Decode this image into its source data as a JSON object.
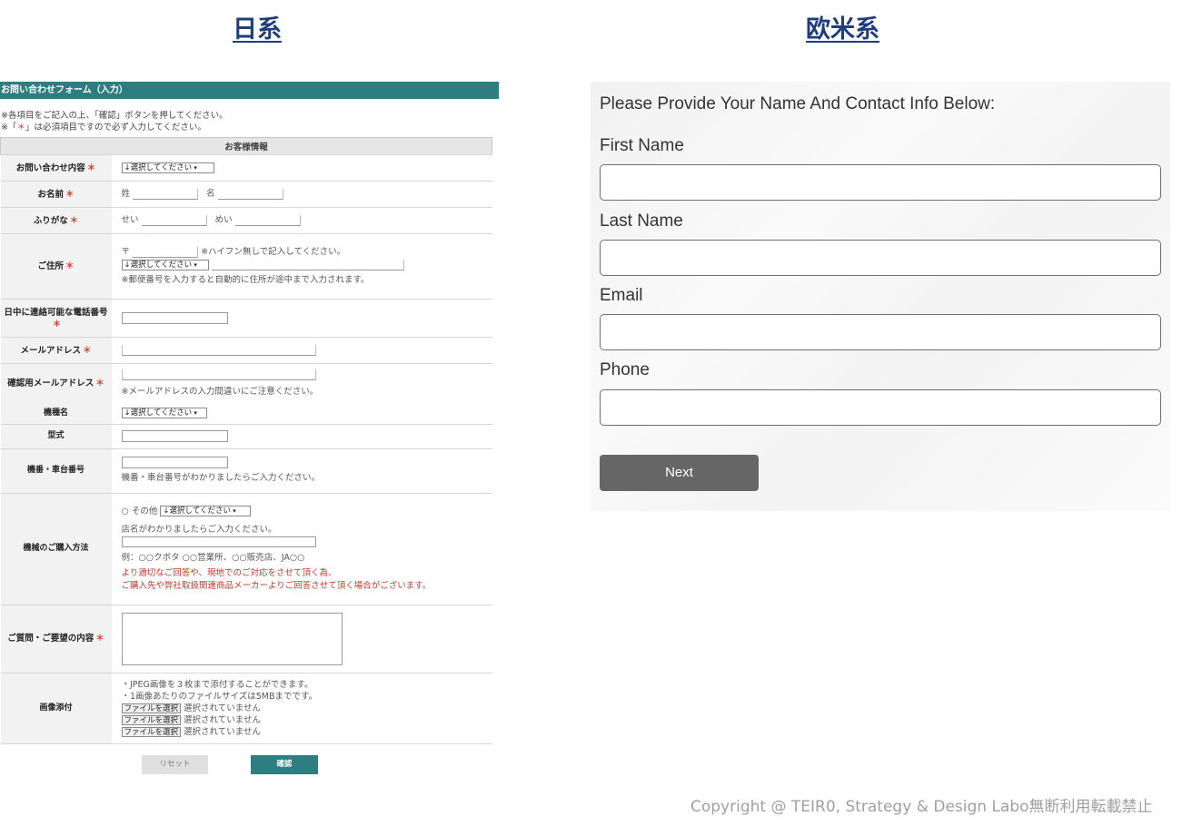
{
  "headings": {
    "jp": "日系",
    "west": "欧米系"
  },
  "jp_form": {
    "title": "お問い合わせフォーム（入力）",
    "note1": "※各項目をご記入の上、「確認」ボタンを押してください。",
    "note2_pre": "※「",
    "note2_mark": "＊",
    "note2_post": "」は必須項目ですので必ず入力してください。",
    "section": "お客様情報",
    "req_mark": "＊",
    "select_placeholder": "↓選択してください",
    "labels": {
      "inquiry": "お問い合わせ内容",
      "name": "お名前",
      "furigana": "ふりがな",
      "address": "ご住所",
      "phone": "日中に連絡可能な電話番号",
      "email": "メールアドレス",
      "email_confirm": "確認用メールアドレス",
      "model_name": "機種名",
      "model_type": "型式",
      "serial": "機番・車台番号",
      "purchase": "機械のご購入方法",
      "question": "ご質問・ご要望の内容",
      "image": "画像添付"
    },
    "name_sei": "姓",
    "name_mei": "名",
    "kana_sei": "せい",
    "kana_mei": "めい",
    "postal_mark": "〒",
    "postal_hint": "※ハイフン無しで記入してください。",
    "address_hint": "※郵便番号を入力すると自動的に住所が途中まで入力されます。",
    "email_hint": "※メールアドレスの入力間違いにご注意ください。",
    "serial_hint": "機番・車台番号がわかりましたらご入力ください。",
    "purchase_other": "その他",
    "purchase_store_hint": "店名がわかりましたらご入力ください。",
    "purchase_example": "例：○○クボタ ○○営業所、○○販売店、JA○○",
    "purchase_red1": "より適切なご回答や、現地でのご対応をさせて頂く為、",
    "purchase_red2": "ご購入先や弊社取扱関連商品メーカーよりご回答させて頂く場合がございます。",
    "image_note1": "・JPEG画像を３枚まで添付することができます。",
    "image_note2": "・1画像あたりのファイルサイズは5MBまでです。",
    "file_button": "ファイルを選択",
    "file_status": "選択されていません",
    "reset": "リセット",
    "confirm": "確認"
  },
  "west_form": {
    "intro": "Please Provide Your Name And Contact Info Below:",
    "first_name": "First Name",
    "last_name": "Last Name",
    "email": "Email",
    "phone": "Phone",
    "next": "Next"
  },
  "copyright": "Copyright @ TEIR0, Strategy & Design Labo無断利用転載禁止"
}
